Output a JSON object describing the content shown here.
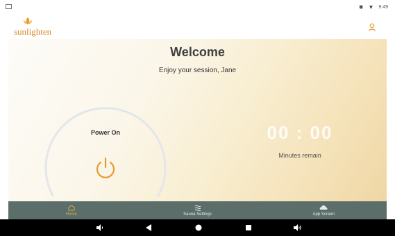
{
  "status_bar": {
    "time": "9:49",
    "icons": [
      "screenshot-icon",
      "bluetooth-icon",
      "wifi-icon"
    ]
  },
  "header": {
    "logo_text": "sunlighten",
    "user_icon": "user-icon"
  },
  "main": {
    "title": "Welcome",
    "subtitle": "Enjoy your session, Jane",
    "power_label": "Power On",
    "power_icon": "power-icon",
    "timer": "00 : 00",
    "timer_label": "Minutes remain"
  },
  "nav": {
    "items": [
      {
        "label": "Home",
        "icon": "home-icon",
        "active": true
      },
      {
        "label": "Sauna Settings",
        "icon": "heat-waves-icon",
        "active": false
      },
      {
        "label": "App Screen",
        "icon": "cloud-icon",
        "active": false
      }
    ]
  },
  "system_bar": {
    "buttons": [
      "volume-down-icon",
      "back-icon",
      "home-circle-icon",
      "recents-icon",
      "volume-up-icon"
    ]
  },
  "colors": {
    "accent": "#e89a2c",
    "nav_bg": "#5b6e69",
    "active_nav": "#d8a84a"
  }
}
